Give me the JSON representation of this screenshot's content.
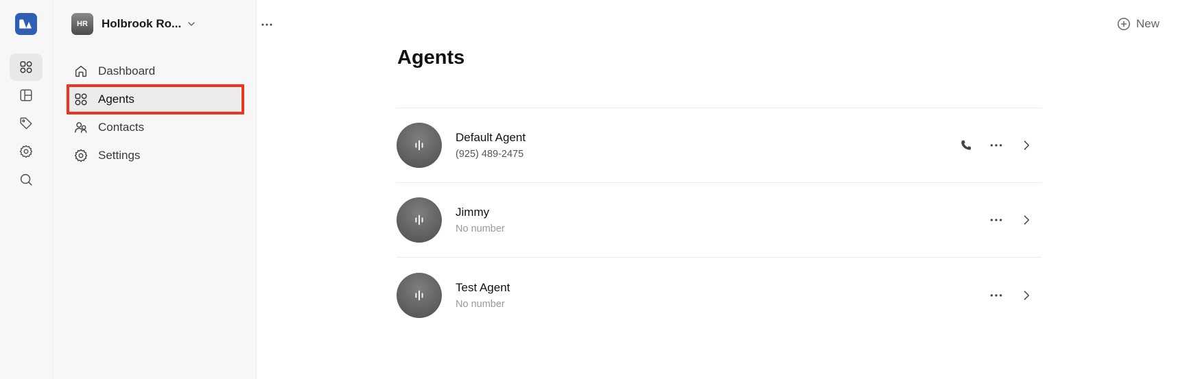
{
  "workspace": {
    "initials": "HR",
    "name": "Holbrook Ro..."
  },
  "nav": {
    "items": [
      {
        "label": "Dashboard"
      },
      {
        "label": "Agents"
      },
      {
        "label": "Contacts"
      },
      {
        "label": "Settings"
      }
    ]
  },
  "header": {
    "new_label": "New"
  },
  "page": {
    "title": "Agents"
  },
  "agents": [
    {
      "name": "Default Agent",
      "number": "(925) 489-2475"
    },
    {
      "name": "Jimmy",
      "number": "No number"
    },
    {
      "name": "Test Agent",
      "number": "No number"
    }
  ],
  "colors": {
    "brand": "#2f5fb4",
    "highlight": "#f0321e"
  }
}
